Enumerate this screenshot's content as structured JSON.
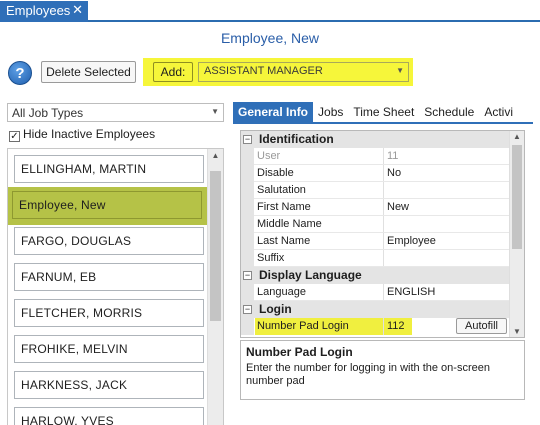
{
  "window": {
    "tab_label": "Employees",
    "tab_close": "✕"
  },
  "page_title": "Employee, New",
  "toolbar": {
    "help_label": "?",
    "delete_label": "Delete Selected",
    "add_label": "Add:",
    "add_value": "ASSISTANT MANAGER"
  },
  "filters": {
    "job_type": "All Job Types",
    "hide_inactive_label": "Hide Inactive Employees",
    "hide_inactive_checked": "✓"
  },
  "employees": [
    "ELLINGHAM, MARTIN",
    "Employee, New",
    "FARGO, DOUGLAS",
    "FARNUM, EB",
    "FLETCHER, MORRIS",
    "FROHIKE, MELVIN",
    "HARKNESS, JACK",
    "HARLOW, YVES"
  ],
  "tabs": [
    "General Info",
    "Jobs",
    "Time Sheet",
    "Schedule",
    "Activi"
  ],
  "property_grid": {
    "identification": {
      "header": "Identification",
      "user_label": "User",
      "user_value": "11",
      "disable_label": "Disable",
      "disable_value": "No",
      "salutation_label": "Salutation",
      "salutation_value": "",
      "first_name_label": "First Name",
      "first_name_value": "New",
      "middle_name_label": "Middle Name",
      "middle_name_value": "",
      "last_name_label": "Last Name",
      "last_name_value": "Employee",
      "suffix_label": "Suffix",
      "suffix_value": ""
    },
    "display_language": {
      "header": "Display Language",
      "language_label": "Language",
      "language_value": "ENGLISH"
    },
    "login": {
      "header": "Login",
      "number_pad_label": "Number Pad Login",
      "number_pad_value": "112",
      "autofill_label": "Autofill"
    },
    "expander_symbol": "−"
  },
  "description": {
    "title": "Number Pad Login",
    "text": "Enter the number for logging in with the on-screen number pad"
  },
  "colors": {
    "accent": "#2f6fb8",
    "highlight": "#f6f63a",
    "selected_item": "#b5c247"
  }
}
